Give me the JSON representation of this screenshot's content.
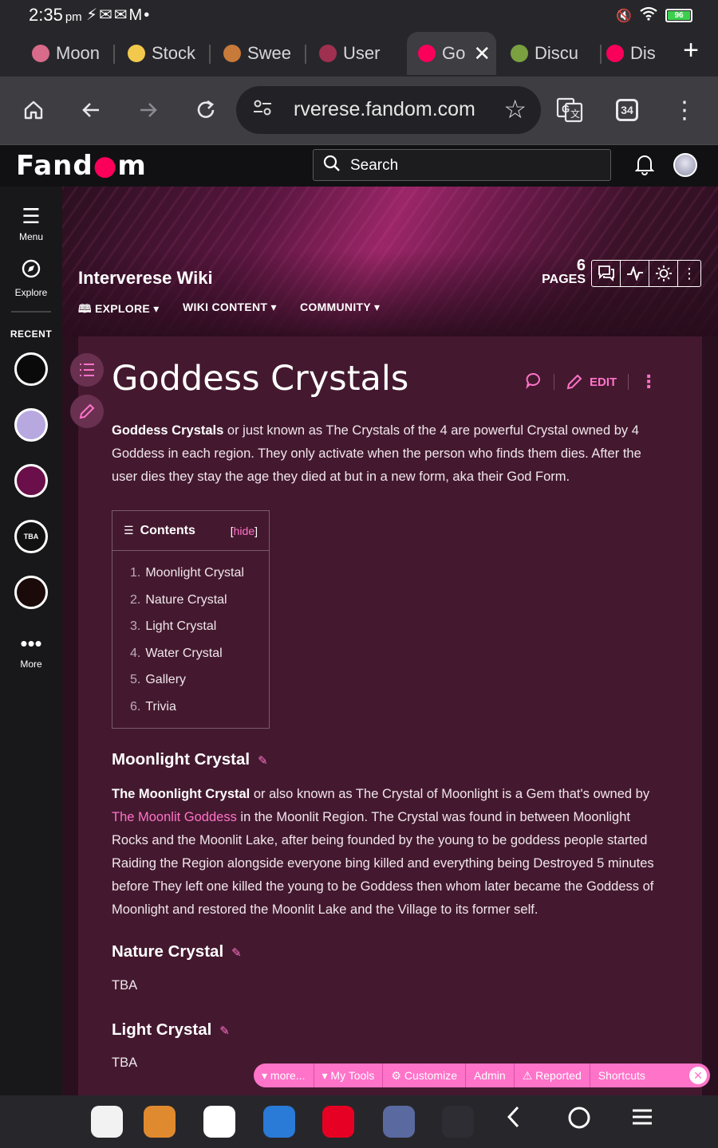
{
  "status": {
    "time": "2:35",
    "ampm": "pm",
    "notif_icons": "⚡✉✉M•",
    "battery": "96"
  },
  "tabs": [
    {
      "label": "Moon",
      "color": "#d86a8a"
    },
    {
      "label": "Stock",
      "color": "#f2c94c"
    },
    {
      "label": "Swee",
      "color": "#c77a3a"
    },
    {
      "label": "User",
      "color": "#a03050"
    },
    {
      "label": "Go",
      "color": "#fa005a",
      "active": true
    },
    {
      "label": "Discu",
      "color": "#7aa040"
    },
    {
      "label": "Dis",
      "color": "#fa005a"
    }
  ],
  "toolbar": {
    "url": "rverese.fandom.com",
    "tab_count": "34"
  },
  "fandom": {
    "logo_pre": "Fand",
    "logo_post": "m",
    "search_placeholder": "Search"
  },
  "rail": {
    "menu": "Menu",
    "explore": "Explore",
    "recent": "RECENT",
    "more": "More",
    "recent_items": [
      {
        "color": "#0a0a0a",
        "text": ""
      },
      {
        "color": "#b7a8e0",
        "text": ""
      },
      {
        "color": "#6a0f4a",
        "text": ""
      },
      {
        "color": "#111111",
        "text": "TBA"
      },
      {
        "color": "#1a0a0a",
        "text": ""
      }
    ]
  },
  "wiki": {
    "name": "Interverese Wiki",
    "nav": [
      "EXPLORE",
      "WIKI CONTENT",
      "COMMUNITY"
    ],
    "page_count": "6",
    "pages_label": "PAGES"
  },
  "article": {
    "title": "Goddess Crystals",
    "edit_label": "EDIT",
    "intro_bold": "Goddess Crystals",
    "intro_rest": " or just known as The Crystals of the 4 are powerful Crystal owned by 4 Goddess in each region. They only activate when the person who finds them dies. After the user dies they stay the age they died at but in a new form, aka their God Form.",
    "toc_title": "Contents",
    "toc_hide": "hide",
    "toc": [
      {
        "num": "1.",
        "label": "Moonlight Crystal"
      },
      {
        "num": "2.",
        "label": "Nature Crystal"
      },
      {
        "num": "3.",
        "label": "Light Crystal"
      },
      {
        "num": "4.",
        "label": "Water Crystal"
      },
      {
        "num": "5.",
        "label": "Gallery"
      },
      {
        "num": "6.",
        "label": "Trivia"
      }
    ],
    "moonlight_heading": "Moonlight Crystal",
    "moonlight_bold": "The Moonlight Crystal",
    "moonlight_a": " or also known as The Crystal of Moonlight is a Gem that's owned by ",
    "moonlight_link": "The Moonlit Goddess",
    "moonlight_b": " in the Moonlit Region. The Crystal was found in between Moonlight Rocks and the Moonlit Lake, after being founded by the young to be goddess people started Raiding the Region alongside everyone bing killed and everything being Destroyed 5 minutes before They left one killed the young to be Goddess then whom later became the Goddess of Moonlight and restored the Moonlit Lake and the Village to its former self.",
    "nature_heading": "Nature Crystal",
    "nature_text": "TBA",
    "light_heading": "Light Crystal",
    "light_text": "TBA"
  },
  "floating_toolbar": {
    "more": "more...",
    "my_tools": "My Tools",
    "customize": "Customize",
    "admin": "Admin",
    "reported": "Reported",
    "shortcuts": "Shortcuts"
  },
  "dock": [
    {
      "name": "app-drawer",
      "color": "#f2f2f2",
      "text": ""
    },
    {
      "name": "game-app",
      "color": "#e08a30",
      "text": ""
    },
    {
      "name": "chrome",
      "color": "#ffffff",
      "text": ""
    },
    {
      "name": "ibis-paint",
      "color": "#2a7ad8",
      "text": ""
    },
    {
      "name": "pinterest",
      "color": "#e60023",
      "text": ""
    },
    {
      "name": "anime-app",
      "color": "#5a6aa0",
      "text": ""
    },
    {
      "name": "bolt-app",
      "color": "#2d2d33",
      "text": ""
    }
  ],
  "colors": {
    "accent": "#ff73c9",
    "fandom_heart": "#fa005a",
    "article_bg": "#44192f"
  }
}
